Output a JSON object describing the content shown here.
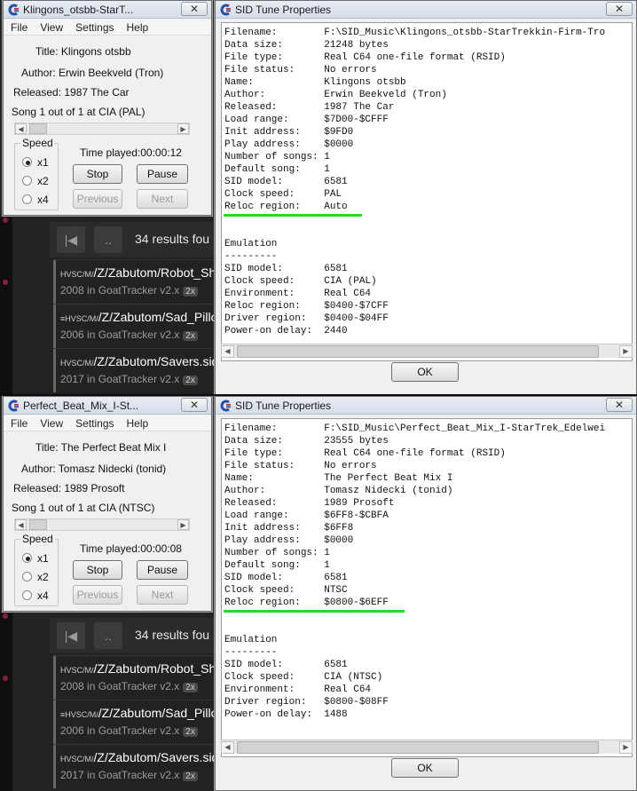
{
  "background_app": {
    "results_text": "34 results fou",
    "prev_button": "|◀",
    "up_button": "..",
    "rows": [
      {
        "prefix": "HVSC/M/",
        "name": "/Z/Zabutom/Robot_Sharks",
        "meta": "2008 in GoatTracker v2.x",
        "badge": "2x"
      },
      {
        "prefix": "≡HVSC/M/",
        "name": "/Z/Zabutom/Sad_Pillow_C",
        "meta": "2006 in GoatTracker v2.x",
        "badge": "2x"
      },
      {
        "prefix": "HVSC/M/",
        "name": "/Z/Zabutom/Savers.sid",
        "meta": "2017 in GoatTracker v2.x",
        "badge": "2x"
      }
    ]
  },
  "windows": [
    {
      "player": {
        "title": "Klingons_otsbb-StarT...",
        "menu": [
          "File",
          "View",
          "Settings",
          "Help"
        ],
        "title_line": "Title: Klingons otsbb",
        "author_line": "Author: Erwin Beekveld (Tron)",
        "released_line": "Released: 1987 The Car",
        "song_line": "Song 1 out of 1 at CIA (PAL)",
        "speed_label": "Speed",
        "speeds": [
          "x1",
          "x2",
          "x4"
        ],
        "time_played": "Time played:00:00:12",
        "stop": "Stop",
        "pause": "Pause",
        "previous": "Previous",
        "next": "Next"
      },
      "properties": {
        "title": "SID Tune Properties",
        "ok": "OK",
        "lines": [
          "Filename:        F:\\SID_Music\\Klingons_otsbb-StarTrekkin-Firm-Tro",
          "Data size:       21248 bytes",
          "File type:       Real C64 one-file format (RSID)",
          "File status:     No errors",
          "Name:            Klingons otsbb",
          "Author:          Erwin Beekveld (Tron)",
          "Released:        1987 The Car",
          "Load range:      $7D00-$CFFF",
          "Init address:    $9FD0",
          "Play address:    $0000",
          "Number of songs: 1",
          "Default song:    1",
          "SID model:       6581",
          "Clock speed:     PAL",
          "Reloc region:    Auto",
          "",
          "",
          "Emulation",
          "---------",
          "SID model:       6581",
          "Clock speed:     CIA (PAL)",
          "Environment:     Real C64",
          "Reloc region:    $0400-$7CFF",
          "Driver region:   $0400-$04FF",
          "Power-on delay:  2440"
        ]
      }
    },
    {
      "player": {
        "title": "Perfect_Beat_Mix_I-St...",
        "menu": [
          "File",
          "View",
          "Settings",
          "Help"
        ],
        "title_line": "Title: The Perfect Beat Mix I",
        "author_line": "Author: Tomasz Nidecki (tonid)",
        "released_line": "Released: 1989 Prosoft",
        "song_line": "Song 1 out of 1 at CIA (NTSC)",
        "speed_label": "Speed",
        "speeds": [
          "x1",
          "x2",
          "x4"
        ],
        "time_played": "Time played:00:00:08",
        "stop": "Stop",
        "pause": "Pause",
        "previous": "Previous",
        "next": "Next"
      },
      "properties": {
        "title": "SID Tune Properties",
        "ok": "OK",
        "lines": [
          "Filename:        F:\\SID_Music\\Perfect_Beat_Mix_I-StarTrek_Edelwei",
          "Data size:       23555 bytes",
          "File type:       Real C64 one-file format (RSID)",
          "File status:     No errors",
          "Name:            The Perfect Beat Mix I",
          "Author:          Tomasz Nidecki (tonid)",
          "Released:        1989 Prosoft",
          "Load range:      $6FF8-$CBFA",
          "Init address:    $6FF8",
          "Play address:    $0000",
          "Number of songs: 1",
          "Default song:    1",
          "SID model:       6581",
          "Clock speed:     NTSC",
          "Reloc region:    $0800-$6EFF",
          "",
          "",
          "Emulation",
          "---------",
          "SID model:       6581",
          "Clock speed:     CIA (NTSC)",
          "Environment:     Real C64",
          "Driver region:   $0800-$08FF",
          "Power-on delay:  1488"
        ]
      }
    }
  ],
  "colors": {
    "highlight_underline": "#22dd22"
  }
}
